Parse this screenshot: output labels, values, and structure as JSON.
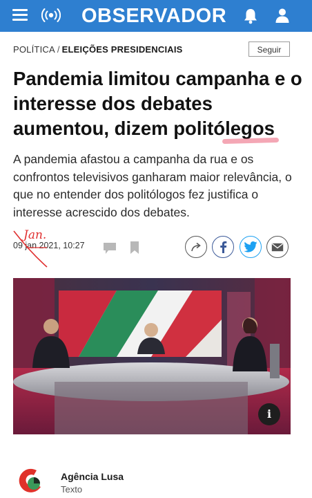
{
  "header": {
    "logo_text": "OBSERVADOR",
    "background_color": "#2e7fd0",
    "icons": [
      "menu-icon",
      "live-radio-icon",
      "bell-icon",
      "user-icon"
    ]
  },
  "breadcrumb": {
    "section": "POLÍTICA",
    "separator": "/",
    "subsection": "ELEIÇÕES PRESIDENCIAIS"
  },
  "follow_label": "Seguir",
  "article": {
    "headline_main": "Pandemia limitou campanha e o interesse dos debates aumentou, dizem politó",
    "headline_marked": "legos",
    "lead": "A pandemia afastou a campanha da rua e os confrontos televisivos ganharam maior relevância, o que no entender dos politólogos fez justifica o interesse acrescido dos debates.",
    "date": "09 jan 2021, 10:27",
    "annotation_text": "Jan."
  },
  "share": {
    "icons": [
      "share-icon",
      "facebook-icon",
      "twitter-icon",
      "mail-icon"
    ],
    "colors": {
      "facebook": "#3b5998",
      "twitter": "#1da1f2",
      "neutral": "#555555"
    }
  },
  "photo": {
    "info_label": "i"
  },
  "author": {
    "name": "Agência Lusa",
    "role": "Texto"
  },
  "annotation_color": "#e03030"
}
